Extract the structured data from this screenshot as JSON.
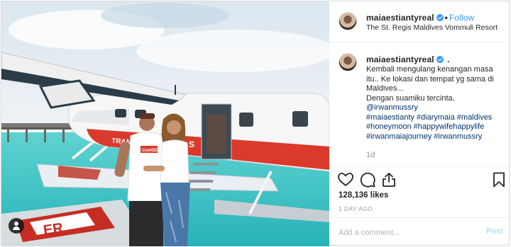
{
  "post": {
    "username": "maiaestiantyreal",
    "follow_label": "Follow",
    "separator": "•",
    "location": "The St. Regis Maldives Vommuli Resort",
    "caption": {
      "username": "maiaestiantyreal",
      "lines": [
        {
          "text": "Kembali mengulang kenangan masa",
          "type": "text"
        },
        {
          "text": "itu.. Ke lokasi dan tempat yg sama di",
          "type": "text"
        },
        {
          "text": "Maldives...",
          "type": "text"
        },
        {
          "text": "Dengan suamiku tercinta.",
          "type": "text"
        },
        {
          "text": "@irwanmussry",
          "type": "tag"
        },
        {
          "text": "#maiaestianty #diarymaia #maldives",
          "type": "tag"
        },
        {
          "text": "#honeymoon #happywifehappylife",
          "type": "tag"
        },
        {
          "text": "#irwanmaiajourney #irwanmussry",
          "type": "tag"
        }
      ],
      "time_ago": "1d"
    },
    "likes": "128,136 likes",
    "date": "1 DAY AGO",
    "comment_placeholder": "Add a comment...",
    "post_label": "Post",
    "photo": {
      "plane_text": "TRANS",
      "plane_text_right": "S",
      "shirt_text": "CoolGEL",
      "dock_text": "ER"
    }
  },
  "icons": [
    "heart-icon",
    "comment-icon",
    "share-icon",
    "bookmark-icon",
    "verified-icon",
    "user-tag-icon"
  ],
  "colors": {
    "accent": "#3897f0",
    "tag": "#003569",
    "plane_red": "#d93a2b",
    "sea": "#4ec7c9"
  }
}
